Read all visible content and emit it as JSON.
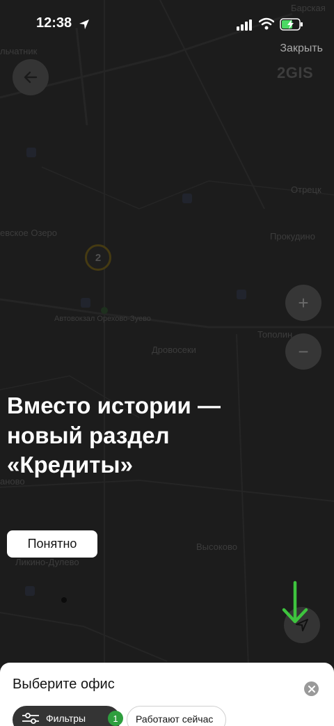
{
  "status_bar": {
    "time": "12:38"
  },
  "header": {
    "close_label": "Закрыть",
    "brand": "2GIS"
  },
  "map": {
    "labels": [
      "Барская",
      "льчатник",
      "Отрецк",
      "евское Озеро",
      "Прокудино",
      "Автовокзал Орехово-Зуево",
      "Тополин",
      "Дровосеки",
      "аново",
      "Высоково",
      "Ликино-Дулево"
    ],
    "cluster_count": "2",
    "zoom_in_label": "+",
    "zoom_out_label": "−"
  },
  "promo": {
    "title_line1": "Вместо истории —",
    "title_line2": "новый раздел",
    "title_line3": "«Кредиты»",
    "button_label": "Понятно",
    "arrow_color": "#3ec43e"
  },
  "bottom_sheet": {
    "title": "Выберите офис",
    "filters_label": "Фильтры",
    "filters_count": "1",
    "open_now_label": "Работают сейчас"
  },
  "colors": {
    "map_background": "#2c2c2c",
    "accent_green": "#2e9e3e",
    "button_white": "#ffffff"
  }
}
